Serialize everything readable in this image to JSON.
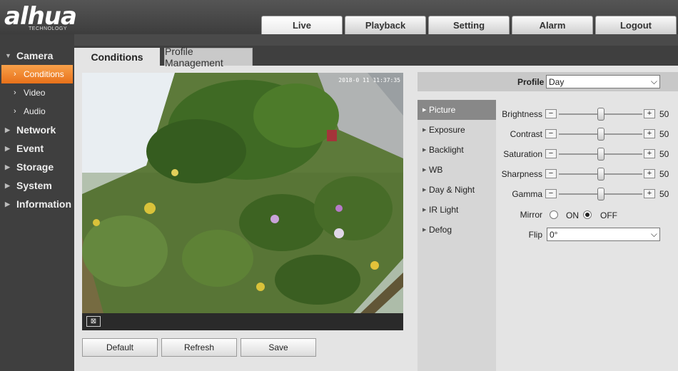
{
  "header": {
    "logo_text": "alhua",
    "logo_sub": "TECHNOLOGY",
    "nav": [
      "Live",
      "Playback",
      "Setting",
      "Alarm",
      "Logout"
    ]
  },
  "sidebar": {
    "camera": "Camera",
    "camera_items": [
      "Conditions",
      "Video",
      "Audio"
    ],
    "groups": [
      "Network",
      "Event",
      "Storage",
      "System",
      "Information"
    ]
  },
  "tabs": {
    "conditions": "Conditions",
    "profile": "Profile Management"
  },
  "video": {
    "timestamp": "2018-0 11 11:37:35"
  },
  "buttons": {
    "default": "Default",
    "refresh": "Refresh",
    "save": "Save"
  },
  "profile": {
    "label": "Profile",
    "value": "Day"
  },
  "menu": [
    "Picture",
    "Exposure",
    "Backlight",
    "WB",
    "Day & Night",
    "IR Light",
    "Defog"
  ],
  "settings": {
    "brightness": {
      "label": "Brightness",
      "value": "50"
    },
    "contrast": {
      "label": "Contrast",
      "value": "50"
    },
    "saturation": {
      "label": "Saturation",
      "value": "50"
    },
    "sharpness": {
      "label": "Sharpness",
      "value": "50"
    },
    "gamma": {
      "label": "Gamma",
      "value": "50"
    },
    "mirror": {
      "label": "Mirror",
      "on": "ON",
      "off": "OFF",
      "selected": "OFF"
    },
    "flip": {
      "label": "Flip",
      "value": "0°"
    }
  }
}
